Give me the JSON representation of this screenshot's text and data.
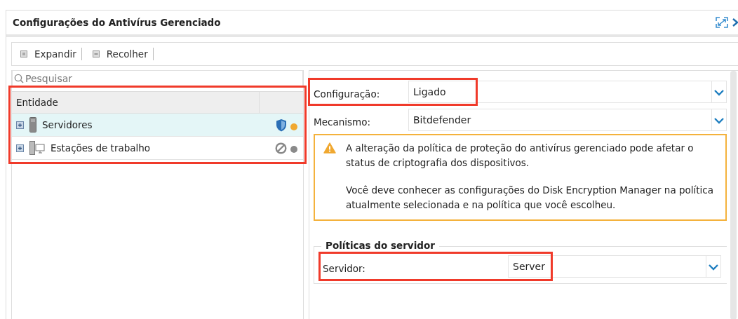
{
  "window": {
    "title": "Configurações do Antivírus Gerenciado"
  },
  "toolbar": [
    {
      "label": "Expandir",
      "kind": "expand"
    },
    {
      "label": "Recolher",
      "kind": "collapse"
    }
  ],
  "search": {
    "placeholder": "Pesquisar"
  },
  "tree": {
    "highlighted": true,
    "columns": [
      "Entidade"
    ],
    "items": [
      {
        "label": "Servidores",
        "kind": "server",
        "selected": true,
        "expanded": false,
        "protected": true,
        "color": "#f0a830"
      },
      {
        "label": "Estações de trabalho",
        "kind": "workstation",
        "selected": false,
        "expanded": false,
        "protected": false,
        "color": "#8a8a8a"
      }
    ]
  },
  "fields": [
    {
      "label": "Configuração:",
      "value": "Ligado",
      "highlighted": true
    },
    {
      "label": "Mecanismo:",
      "value": "Bitdefender",
      "highlighted": false
    }
  ],
  "warning": {
    "paragraphs": [
      "A alteração da política de proteção do antivírus gerenciado pode afetar o status de criptografia dos dispositivos.",
      "Você deve conhecer as configurações do Disk Encryption Manager na política atualmente selecionada e na política que você escolheu."
    ]
  },
  "server_policies": {
    "title": "Políticas do servidor",
    "fields": [
      {
        "label": "Servidor:",
        "value": "Server",
        "highlighted": true
      }
    ]
  }
}
